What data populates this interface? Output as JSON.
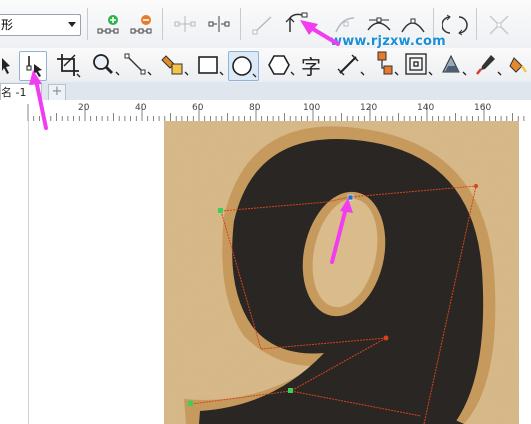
{
  "toolbar": {
    "shape_combo_value": "形",
    "watermark": "www.rjzxw.com"
  },
  "tab": {
    "document_name": "名 -1",
    "add_label": "+"
  },
  "ruler": {
    "ticks": [
      "20",
      "40",
      "60",
      "80",
      "100",
      "120",
      "140",
      "160"
    ]
  },
  "tools": {
    "text_tool_glyph": "字"
  },
  "colors": {
    "accent_arrow": "#f23cf0",
    "node_line": "#d6441c",
    "node_green": "#39d15a",
    "digit_fill": "#2a2624",
    "paper": "#d8b98a"
  }
}
